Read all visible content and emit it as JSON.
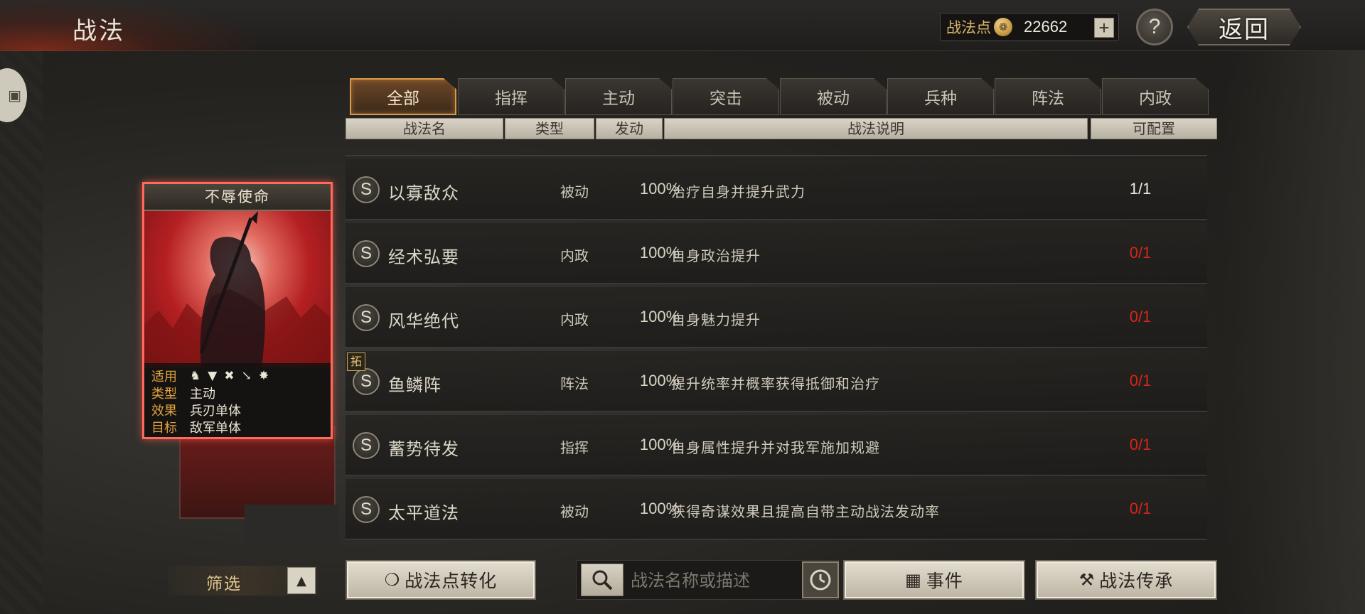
{
  "header": {
    "title": "战法",
    "points_label": "战法点",
    "points_value": "22662",
    "plus_label": "+",
    "help_label": "?",
    "back_label": "返回"
  },
  "tabs": [
    {
      "label": "全部",
      "active": true
    },
    {
      "label": "指挥",
      "active": false
    },
    {
      "label": "主动",
      "active": false
    },
    {
      "label": "突击",
      "active": false
    },
    {
      "label": "被动",
      "active": false
    },
    {
      "label": "兵种",
      "active": false
    },
    {
      "label": "阵法",
      "active": false
    },
    {
      "label": "内政",
      "active": false
    }
  ],
  "columns": [
    "战法名",
    "类型",
    "发动",
    "战法说明",
    "可配置"
  ],
  "rows": [
    {
      "grade": "S",
      "name": "以寡敌众",
      "type": "被动",
      "rate": "100%",
      "desc": "治疗自身并提升武力",
      "cfg": "1/1",
      "cfg_color": "#eeeae0"
    },
    {
      "grade": "S",
      "name": "经术弘要",
      "type": "内政",
      "rate": "100%",
      "desc": "自身政治提升",
      "cfg": "0/1",
      "cfg_color": "#d8231d"
    },
    {
      "grade": "S",
      "name": "风华绝代",
      "type": "内政",
      "rate": "100%",
      "desc": "自身魅力提升",
      "cfg": "0/1",
      "cfg_color": "#d8231d"
    },
    {
      "grade": "S",
      "name": "鱼鳞阵",
      "type": "阵法",
      "rate": "100%",
      "desc": "提升统率并概率获得抵御和治疗",
      "cfg": "0/1",
      "cfg_color": "#d8231d"
    },
    {
      "grade": "S",
      "name": "蓄势待发",
      "type": "指挥",
      "rate": "100%",
      "desc": "自身属性提升并对我军施加规避",
      "cfg": "0/1",
      "cfg_color": "#d8231d"
    },
    {
      "grade": "S",
      "name": "太平道法",
      "type": "被动",
      "rate": "100%",
      "desc": "获得奇谋效果且提高自带主动战法发动率",
      "cfg": "0/1",
      "cfg_color": "#d8231d"
    }
  ],
  "tuo_badge": "拓",
  "card": {
    "title": "不辱使命",
    "applicable_label": "适用",
    "type_label": "类型",
    "type_value": "主动",
    "effect_label": "效果",
    "effect_value": "兵刃单体",
    "target_label": "目标",
    "target_value": "敌军单体",
    "unit_icons": [
      "cavalry-icon",
      "shield-icon",
      "archer-icon",
      "spear-icon",
      "wheel-icon"
    ]
  },
  "bottom": {
    "filter_label": "筛选",
    "convert_label": "战法点转化",
    "search_placeholder": "战法名称或描述",
    "event_label": "事件",
    "inherit_label": "战法传承"
  }
}
